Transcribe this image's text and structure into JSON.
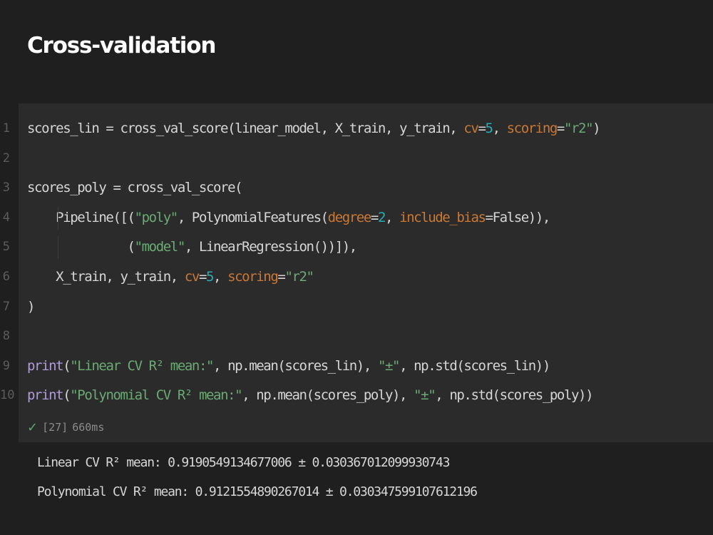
{
  "section": {
    "title": "Cross-validation"
  },
  "gutter": [
    "1",
    "2",
    "3",
    "4",
    "5",
    "6",
    "7",
    "8",
    "9",
    "10"
  ],
  "code": {
    "l1": {
      "a": "scores_lin = cross_val_score(linear_model, X_train, y_train, ",
      "k1": "cv",
      "eq1": "=",
      "n1": "5",
      "sep": ", ",
      "k2": "scoring",
      "eq2": "=",
      "s1": "\"r2\"",
      "end": ")"
    },
    "l3": {
      "a": "scores_poly = cross_val_score("
    },
    "l4": {
      "a": "Pipeline([(",
      "s1": "\"poly\"",
      "b": ", PolynomialFeatures(",
      "k1": "degree",
      "eq1": "=",
      "n1": "2",
      "sep": ", ",
      "k2": "include_bias",
      "eq2": "=",
      "c": "False",
      "end": ")),"
    },
    "l5": {
      "a": "(",
      "s1": "\"model\"",
      "end": ", LinearRegression())]),"
    },
    "l6": {
      "a": "X_train, y_train, ",
      "k1": "cv",
      "eq1": "=",
      "n1": "5",
      "sep": ", ",
      "k2": "scoring",
      "eq2": "=",
      "s1": "\"r2\""
    },
    "l7": {
      "a": ")"
    },
    "l9": {
      "fn": "print",
      "a": "(",
      "s1": "\"Linear CV R² mean:\"",
      "b": ", np.mean(scores_lin), ",
      "s2": "\"±\"",
      "end": ", np.std(scores_lin))"
    },
    "l10": {
      "fn": "print",
      "a": "(",
      "s1": "\"Polynomial CV R² mean:\"",
      "b": ", np.mean(scores_poly), ",
      "s2": "\"±\"",
      "end": ", np.std(scores_poly))"
    }
  },
  "execution": {
    "count": "[27]",
    "duration": "660ms"
  },
  "output": [
    "Linear CV R² mean: 0.9190549134677006 ± 0.030367012099930743",
    "Polynomial CV R² mean: 0.9121554890267014 ± 0.030347599107612196"
  ]
}
